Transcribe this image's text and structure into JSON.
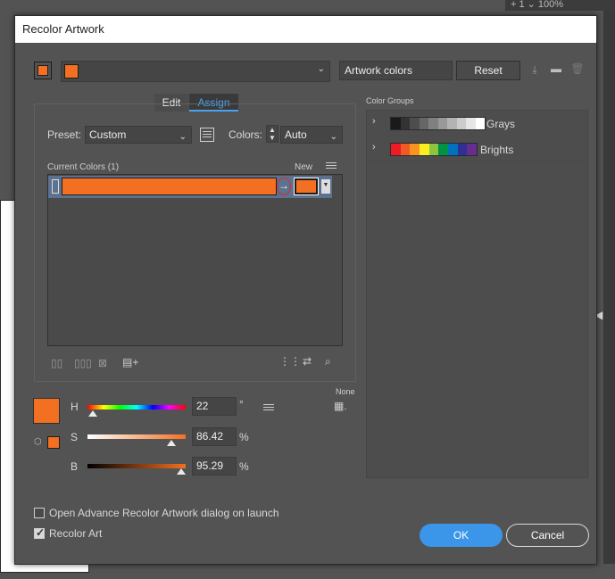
{
  "background": {
    "top_label": "+ 1  ⌄  100%"
  },
  "dialog": {
    "title": "Recolor Artwork",
    "artwork_colors_label": "Artwork colors",
    "reset_label": "Reset",
    "tabs": {
      "edit": "Edit",
      "assign": "Assign"
    },
    "preset_label": "Preset:",
    "preset_value": "Custom",
    "colors_label": "Colors:",
    "colors_value": "Auto",
    "current_colors_label": "Current Colors (1)",
    "new_label": "New",
    "none_label": "None",
    "hsb": {
      "h_label": "H",
      "h_value": "22",
      "h_unit": "°",
      "s_label": "S",
      "s_value": "86.42",
      "s_unit": "%",
      "b_label": "B",
      "b_value": "95.29",
      "b_unit": "%"
    },
    "color_groups_label": "Color Groups",
    "groups": [
      {
        "name": "Grays",
        "colors": [
          "#1a1a1a",
          "#333333",
          "#4d4d4d",
          "#666666",
          "#808080",
          "#999999",
          "#b3b3b3",
          "#cccccc",
          "#e6e6e6",
          "#ffffff"
        ]
      },
      {
        "name": "Brights",
        "colors": [
          "#ed1c24",
          "#f15a24",
          "#f7931e",
          "#fcee21",
          "#8cc63f",
          "#009245",
          "#0071bc",
          "#2e3192",
          "#662d91"
        ]
      }
    ],
    "advance_checkbox_label": "Open Advance Recolor Artwork dialog on launch",
    "recolor_art_label": "Recolor Art",
    "ok_label": "OK",
    "cancel_label": "Cancel",
    "accent_color": "#f36f21",
    "ok_color": "#3b95e8"
  }
}
